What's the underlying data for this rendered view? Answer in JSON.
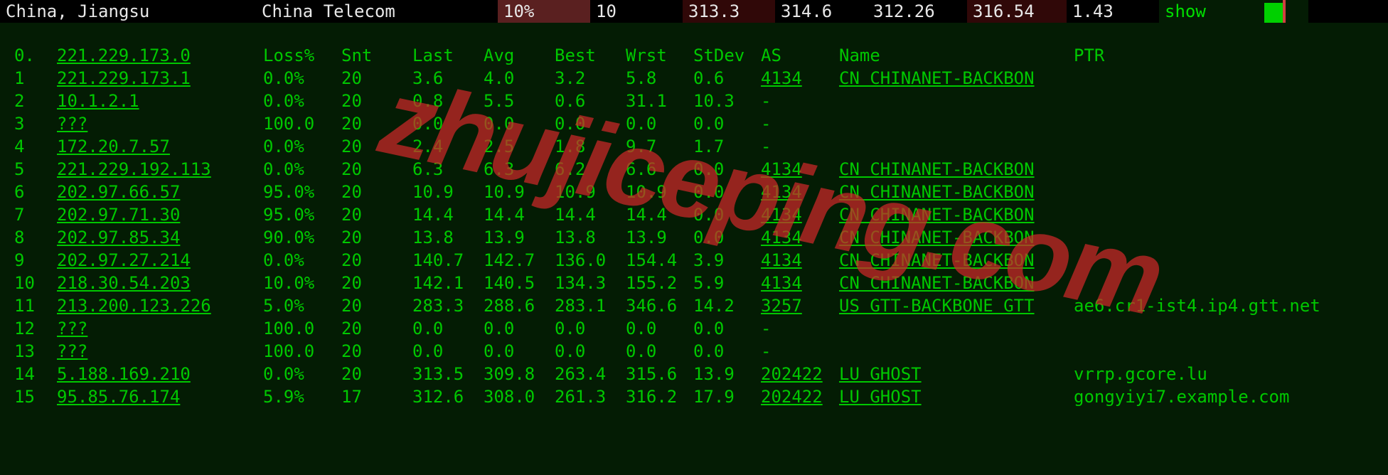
{
  "topbar": {
    "location": "China, Jiangsu",
    "isp": "China Telecom",
    "loss": "10%",
    "snt": "10",
    "m1": "313.3",
    "m2": "314.6",
    "m3": "312.26",
    "m4": "316.54",
    "m5": "1.43",
    "show": "show"
  },
  "header": {
    "n": "0.",
    "ip": "221.229.173.0",
    "loss": "Loss%",
    "snt": "Snt",
    "last": "Last",
    "avg": "Avg",
    "best": "Best",
    "wrst": "Wrst",
    "std": "StDev",
    "as": "AS",
    "name": "Name",
    "ptr": "PTR"
  },
  "rows": [
    {
      "n": "1",
      "ip": "221.229.173.1",
      "loss": "0.0%",
      "snt": "20",
      "last": "3.6",
      "avg": "4.0",
      "best": "3.2",
      "wrst": "5.8",
      "std": "0.6",
      "as": "4134",
      "name": "CN CHINANET-BACKBON",
      "ptr": ""
    },
    {
      "n": "2",
      "ip": "10.1.2.1",
      "loss": "0.0%",
      "snt": "20",
      "last": "0.8",
      "avg": "5.5",
      "best": "0.6",
      "wrst": "31.1",
      "std": "10.3",
      "as": "-",
      "name": "",
      "ptr": ""
    },
    {
      "n": "3",
      "ip": "???",
      "loss": "100.0",
      "snt": "20",
      "last": "0.0",
      "avg": "0.0",
      "best": "0.0",
      "wrst": "0.0",
      "std": "0.0",
      "as": "-",
      "name": "",
      "ptr": ""
    },
    {
      "n": "4",
      "ip": "172.20.7.57",
      "loss": "0.0%",
      "snt": "20",
      "last": "2.4",
      "avg": "2.5",
      "best": "1.8",
      "wrst": "9.7",
      "std": "1.7",
      "as": "-",
      "name": "",
      "ptr": ""
    },
    {
      "n": "5",
      "ip": "221.229.192.113",
      "loss": "0.0%",
      "snt": "20",
      "last": "6.3",
      "avg": "6.3",
      "best": "6.2",
      "wrst": "6.6",
      "std": "0.0",
      "as": "4134",
      "name": "CN CHINANET-BACKBON",
      "ptr": ""
    },
    {
      "n": "6",
      "ip": "202.97.66.57",
      "loss": "95.0%",
      "snt": "20",
      "last": "10.9",
      "avg": "10.9",
      "best": "10.9",
      "wrst": "10.9",
      "std": "0.0",
      "as": "4134",
      "name": "CN CHINANET-BACKBON",
      "ptr": ""
    },
    {
      "n": "7",
      "ip": "202.97.71.30",
      "loss": "95.0%",
      "snt": "20",
      "last": "14.4",
      "avg": "14.4",
      "best": "14.4",
      "wrst": "14.4",
      "std": "0.0",
      "as": "4134",
      "name": "CN CHINANET-BACKBON",
      "ptr": ""
    },
    {
      "n": "8",
      "ip": "202.97.85.34",
      "loss": "90.0%",
      "snt": "20",
      "last": "13.8",
      "avg": "13.9",
      "best": "13.8",
      "wrst": "13.9",
      "std": "0.0",
      "as": "4134",
      "name": "CN CHINANET-BACKBON",
      "ptr": ""
    },
    {
      "n": "9",
      "ip": "202.97.27.214",
      "loss": "0.0%",
      "snt": "20",
      "last": "140.7",
      "avg": "142.7",
      "best": "136.0",
      "wrst": "154.4",
      "std": "3.9",
      "as": "4134",
      "name": "CN CHINANET-BACKBON",
      "ptr": ""
    },
    {
      "n": "10",
      "ip": "218.30.54.203",
      "loss": "10.0%",
      "snt": "20",
      "last": "142.1",
      "avg": "140.5",
      "best": "134.3",
      "wrst": "155.2",
      "std": "5.9",
      "as": "4134",
      "name": "CN CHINANET-BACKBON",
      "ptr": ""
    },
    {
      "n": "11",
      "ip": "213.200.123.226",
      "loss": "5.0%",
      "snt": "20",
      "last": "283.3",
      "avg": "288.6",
      "best": "283.1",
      "wrst": "346.6",
      "std": "14.2",
      "as": "3257",
      "name": "US GTT-BACKBONE GTT",
      "ptr": "ae6.cr1-ist4.ip4.gtt.net"
    },
    {
      "n": "12",
      "ip": "???",
      "loss": "100.0",
      "snt": "20",
      "last": "0.0",
      "avg": "0.0",
      "best": "0.0",
      "wrst": "0.0",
      "std": "0.0",
      "as": "-",
      "name": "",
      "ptr": ""
    },
    {
      "n": "13",
      "ip": "???",
      "loss": "100.0",
      "snt": "20",
      "last": "0.0",
      "avg": "0.0",
      "best": "0.0",
      "wrst": "0.0",
      "std": "0.0",
      "as": "-",
      "name": "",
      "ptr": ""
    },
    {
      "n": "14",
      "ip": "5.188.169.210",
      "loss": "0.0%",
      "snt": "20",
      "last": "313.5",
      "avg": "309.8",
      "best": "263.4",
      "wrst": "315.6",
      "std": "13.9",
      "as": "202422",
      "name": "LU GHOST",
      "ptr": "vrrp.gcore.lu"
    },
    {
      "n": "15",
      "ip": "95.85.76.174",
      "loss": "5.9%",
      "snt": "17",
      "last": "312.6",
      "avg": "308.0",
      "best": "261.3",
      "wrst": "316.2",
      "std": "17.9",
      "as": "202422",
      "name": "LU GHOST",
      "ptr": "gongyiyi7.example.com"
    }
  ],
  "watermark": "zhujiceping.com"
}
